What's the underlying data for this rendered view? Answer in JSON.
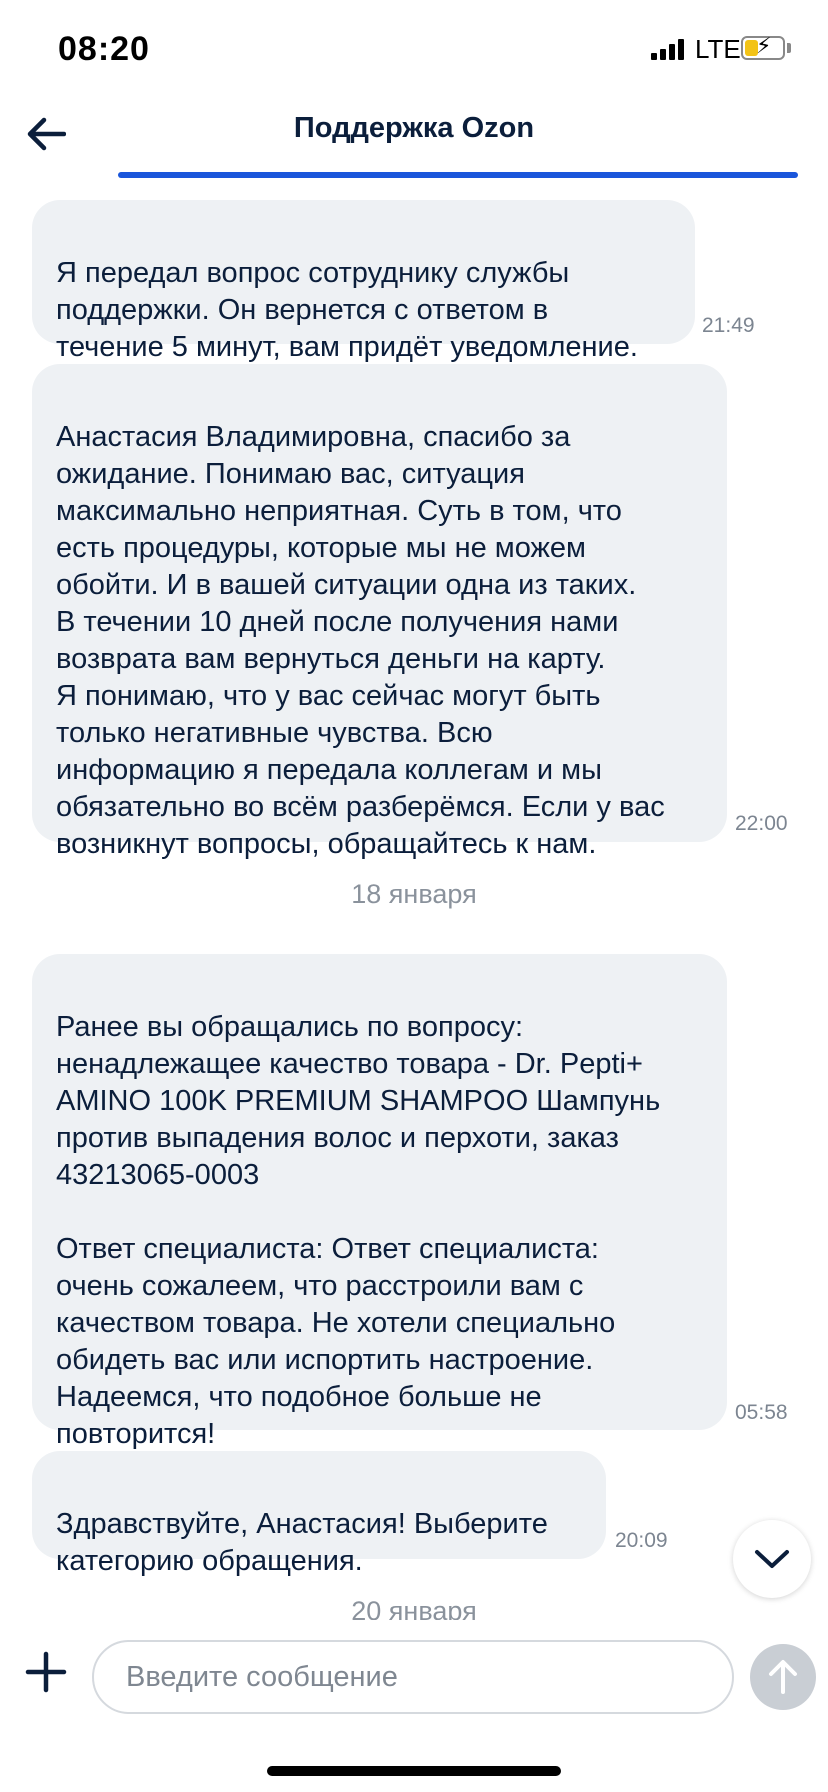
{
  "status_bar": {
    "time": "08:20",
    "network": "LTE",
    "battery_level": 0.35,
    "battery_color": "#f3c316"
  },
  "header": {
    "title": "Поддержка Ozon",
    "back_icon": "arrow-left-icon",
    "accent_color": "#1a56db"
  },
  "messages": [
    {
      "text": "Я передал вопрос сотруднику службы\nподдержки. Он вернется с ответом в\nтечение 5 минут, вам придёт уведомление.",
      "time": "21:49"
    },
    {
      "text": "Анастасия Владимировна, спасибо за\nожидание. Понимаю вас, ситуация\nмаксимально неприятная. Суть в том, что\nесть процедуры, которые мы не можем\nобойти. И в вашей ситуации одна из таких.\nВ течении 10 дней после получения нами\nвозврата вам вернуться деньги на карту.\nЯ понимаю, что у вас сейчас могут быть\nтолько негативные чувства. Всю\nинформацию я передала коллегам и мы\nобязательно во всём разберёмся. Если у вас\nвозникнут вопросы, обращайтесь к нам.",
      "time": "22:00"
    },
    {
      "text": "Ранее вы обращались по вопросу:\nненадлежащее качество товара - Dr. Pepti+\nAMINO 100K PREMIUM SHAMPOO Шампунь\nпротив выпадения волос и перхоти, заказ\n43213065-0003\n\nОтвет специалиста: Ответ специалиста:\nочень сожалеем, что расстроили вам с\nкачеством товара. Не хотели специально\nобидеть вас или испортить настроение.\nНадеемся, что подобное больше не\nповторится!",
      "time": "05:58"
    },
    {
      "text": "Здравствуйте, Анастасия! Выберите\nкатегорию обращения.",
      "time": "20:09"
    }
  ],
  "date_separators": [
    "18 января",
    "20 января"
  ],
  "scroll_down_icon": "chevron-down-icon",
  "composer": {
    "placeholder": "Введите сообщение",
    "value": "",
    "attach_icon": "plus-icon",
    "send_icon": "arrow-up-icon"
  }
}
